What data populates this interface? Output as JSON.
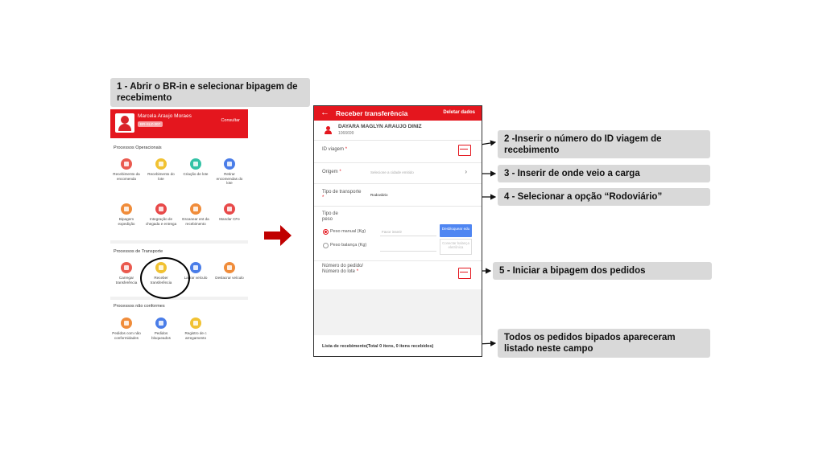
{
  "callouts": {
    "step1": "1 - Abrir o BR-in e selecionar bipagem de recebimento",
    "step2": "2 -Inserir o número do ID viagem de recebimento",
    "step3": "3 - Inserir de onde veio a carga",
    "step4": "4 - Selecionar a opção “Rodoviário”",
    "step5": "5 - Iniciar a bipagem dos pedidos",
    "list_note": "Todos os pedidos bipados apareceram listado neste campo"
  },
  "home": {
    "user_name": "Marcela Araujo Moraes",
    "user_badge": "BR-SLZ-307",
    "consult_label": "Consultar",
    "sections": {
      "operational": "Processos Operacionais",
      "transport": "Processos de Transporte",
      "non_conform": "Processos não conformes"
    },
    "operational_items": [
      {
        "label": "Recebimento da encomenda",
        "color": "#ea5a4f"
      },
      {
        "label": "Recebimento do lote",
        "color": "#f1c232"
      },
      {
        "label": "Criação de lote",
        "color": "#33c2a6"
      },
      {
        "label": "Retirar encomendas do lote",
        "color": "#4a7de8"
      },
      {
        "label": "Bipagem expedição",
        "color": "#f08c3a"
      },
      {
        "label": "Integração de chegada e entrega",
        "color": "#e84a4a"
      },
      {
        "label": "Escanear ent da recebimento",
        "color": "#f08c3a"
      },
      {
        "label": "Mandar CFe",
        "color": "#e84a4a"
      }
    ],
    "transport_items": [
      {
        "label": "Carregar transferência",
        "color": "#ea5a4f"
      },
      {
        "label": "Receber transferência",
        "color": "#f1c232"
      },
      {
        "label": "Lacrar veículo",
        "color": "#4a7de8"
      },
      {
        "label": "Deslacrar veículo",
        "color": "#f08c3a"
      }
    ],
    "non_conform_items": [
      {
        "label": "Pedidos com não conformidades",
        "color": "#f08c3a"
      },
      {
        "label": "Pedidos bloqueados",
        "color": "#4a7de8"
      },
      {
        "label": "Registro de c arregamento",
        "color": "#f1c232"
      }
    ]
  },
  "receive": {
    "title": "Receber transferência",
    "delete_label": "Deletar dados",
    "user_name": "DAYARA MAGLYN ARAUJO DINIZ",
    "user_id": "1066699",
    "id_viagem_label": "ID viagem",
    "origem_label": "Origem",
    "origem_placeholder": "Selecione a cidade emitido",
    "tipo_transporte_label": "Tipo de transporte",
    "tipo_transporte_value": "Rodoviário",
    "tipo_peso_label": "Tipo de peso",
    "peso_manual_label": "Peso manual (Kg)",
    "peso_manual_placeholder": "Favor inserir",
    "peso_balanca_label": "Peso balança (Kg)",
    "unlock_button": "Desbloquear edu",
    "connect_button": "Conectar balança eletrônica",
    "pedido_label": "Número do pedido/ Número do lote",
    "required_mark": "*",
    "list_label": "Lista de recebimento(Total 0 itens, 0 itens recebidos)"
  }
}
